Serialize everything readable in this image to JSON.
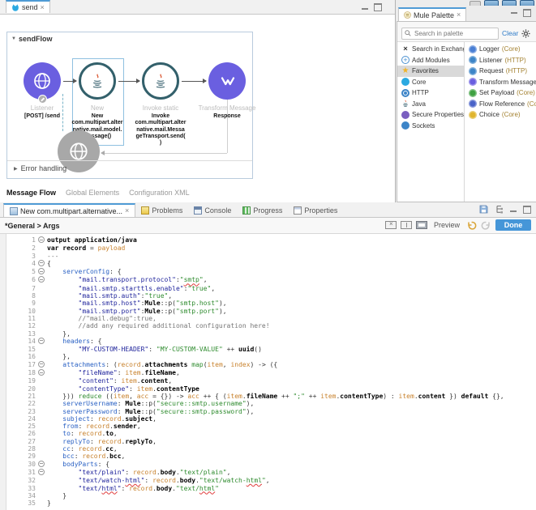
{
  "colors": {
    "accent_blue": "#4596d8",
    "link_blue": "#2f7cc9",
    "suffix_tan": "#a3802f",
    "node_purple": "#6a5fe0",
    "selection_blue": "#8fc0e0"
  },
  "icons": {
    "tri_down": "▼",
    "tri_right": "▶",
    "close": "×",
    "star": "★",
    "add": "+",
    "exchange": "×"
  },
  "flow_editor": {
    "tab": "send",
    "flow_name": "sendFlow",
    "nodes": [
      {
        "type": "Listener",
        "name_lines": [
          "[POST] /send"
        ]
      },
      {
        "type": "New",
        "name_lines": [
          "New",
          "com.multipart.alter",
          "native.mail.model.",
          "Message()"
        ],
        "selected": true
      },
      {
        "type": "Invoke static",
        "name_lines": [
          "Invoke",
          "com.multipart.alter",
          "native.mail.Messa",
          "geTransport.send(",
          ")"
        ]
      },
      {
        "type": "Transform Message",
        "name_lines": [
          "Response"
        ]
      }
    ],
    "error_handling_label": "Error handling",
    "view_tabs": [
      "Message Flow",
      "Global Elements",
      "Configuration XML"
    ]
  },
  "palette": {
    "tab": "Mule Palette",
    "search_placeholder": "Search in palette",
    "clear_label": "Clear",
    "categories": [
      {
        "label": "Search in Exchange..",
        "icon": "exchange"
      },
      {
        "label": "Add Modules",
        "icon": "add"
      },
      {
        "label": "Favorites",
        "icon": "star",
        "selected": true
      },
      {
        "label": "Core",
        "icon": "mule"
      },
      {
        "label": "HTTP",
        "icon": "http"
      },
      {
        "label": "Java",
        "icon": "java"
      },
      {
        "label": "Secure Properties",
        "icon": "secure"
      },
      {
        "label": "Sockets",
        "icon": "sockets"
      }
    ],
    "components": [
      {
        "name": "Logger",
        "suffix": "(Core)",
        "color": "#4a7fd4"
      },
      {
        "name": "Listener",
        "suffix": "(HTTP)",
        "color": "#3d85c8"
      },
      {
        "name": "Request",
        "suffix": "(HTTP)",
        "color": "#3d85c8"
      },
      {
        "name": "Transform Message",
        "suffix": "(Core)",
        "color": "#6a5fe0"
      },
      {
        "name": "Set Payload",
        "suffix": "(Core)",
        "color": "#3fa142"
      },
      {
        "name": "Flow Reference",
        "suffix": "(Core)",
        "color": "#4a63c8"
      },
      {
        "name": "Choice",
        "suffix": "(Core)",
        "color": "#e0b52e"
      }
    ]
  },
  "bottom_panel": {
    "tabs": [
      {
        "label": "New com.multipart.alternative...",
        "icon": "dwfile",
        "active": true,
        "closable": true
      },
      {
        "label": "Problems",
        "icon": "problems"
      },
      {
        "label": "Console",
        "icon": "console"
      },
      {
        "label": "Progress",
        "icon": "progress"
      },
      {
        "label": "Properties",
        "icon": "properties"
      }
    ],
    "breadcrumb": "*General > Args",
    "preview_label": "Preview",
    "done_label": "Done"
  },
  "code": {
    "lines": [
      {
        "n": 1,
        "f": 1,
        "seg": [
          [
            "output application/java",
            "k"
          ]
        ]
      },
      {
        "n": 2,
        "seg": [
          [
            "var",
            "k"
          ],
          [
            " ",
            ""
          ],
          [
            "record",
            "b"
          ],
          [
            " = ",
            ""
          ],
          [
            "payload",
            "v"
          ]
        ]
      },
      {
        "n": 3,
        "seg": [
          [
            "---",
            "c"
          ]
        ]
      },
      {
        "n": 4,
        "f": 1,
        "seg": [
          [
            "{",
            ""
          ]
        ]
      },
      {
        "n": 5,
        "f": 1,
        "seg": [
          [
            "    ",
            ""
          ],
          [
            "serverConfig",
            "key"
          ],
          [
            ": {",
            ""
          ]
        ]
      },
      {
        "n": 6,
        "f": 1,
        "seg": [
          [
            "        ",
            ""
          ],
          [
            "\"mail.transport.protocol\"",
            "q"
          ],
          [
            ":",
            ""
          ],
          [
            "\"",
            "s"
          ],
          [
            "smtp",
            "s w"
          ],
          [
            "\"",
            "s"
          ],
          [
            ",",
            ""
          ]
        ]
      },
      {
        "n": 7,
        "seg": [
          [
            "        ",
            ""
          ],
          [
            "\"mail.smtp.starttls.enable\"",
            "q"
          ],
          [
            ":",
            ""
          ],
          [
            "\"true\"",
            "s"
          ],
          [
            ",",
            ""
          ]
        ]
      },
      {
        "n": 8,
        "seg": [
          [
            "        ",
            ""
          ],
          [
            "\"mail.smtp.auth\"",
            "q"
          ],
          [
            ":",
            ""
          ],
          [
            "\"true\"",
            "s"
          ],
          [
            ",",
            ""
          ]
        ]
      },
      {
        "n": 9,
        "seg": [
          [
            "        ",
            ""
          ],
          [
            "\"mail.smtp.host\"",
            "q"
          ],
          [
            ":",
            ""
          ],
          [
            "Mule",
            "b"
          ],
          [
            "::p(",
            ""
          ],
          [
            "\"smtp.host\"",
            "s"
          ],
          [
            "),",
            ""
          ]
        ]
      },
      {
        "n": 10,
        "seg": [
          [
            "        ",
            ""
          ],
          [
            "\"mail.smtp.port\"",
            "q"
          ],
          [
            ":",
            ""
          ],
          [
            "Mule",
            "b"
          ],
          [
            "::p(",
            ""
          ],
          [
            "\"smtp.port\"",
            "s"
          ],
          [
            "),",
            ""
          ]
        ]
      },
      {
        "n": 11,
        "seg": [
          [
            "        ",
            ""
          ],
          [
            "//\"mail.debug\":true,",
            "c"
          ]
        ]
      },
      {
        "n": 12,
        "seg": [
          [
            "        ",
            ""
          ],
          [
            "//add any required additional configuration here!",
            "c"
          ]
        ]
      },
      {
        "n": 13,
        "seg": [
          [
            "    },",
            ""
          ]
        ]
      },
      {
        "n": 14,
        "f": 1,
        "seg": [
          [
            "    ",
            ""
          ],
          [
            "headers",
            "key"
          ],
          [
            ": {",
            ""
          ]
        ]
      },
      {
        "n": 15,
        "seg": [
          [
            "        ",
            ""
          ],
          [
            "\"MY-CUSTOM-HEADER\"",
            "q"
          ],
          [
            ": ",
            ""
          ],
          [
            "\"MY-CUSTOM-VALUE\"",
            "s"
          ],
          [
            " ++ ",
            ""
          ],
          [
            "uuid",
            "b"
          ],
          [
            "()",
            ""
          ]
        ]
      },
      {
        "n": 16,
        "seg": [
          [
            "    },",
            ""
          ]
        ]
      },
      {
        "n": 17,
        "f": 1,
        "seg": [
          [
            "    ",
            ""
          ],
          [
            "attachments",
            "key"
          ],
          [
            ": (",
            ""
          ],
          [
            "record",
            "v"
          ],
          [
            ".",
            ""
          ],
          [
            "attachments",
            "b"
          ],
          [
            " ",
            ""
          ],
          [
            "map",
            "f"
          ],
          [
            "(",
            ""
          ],
          [
            "item",
            "v"
          ],
          [
            ", ",
            ""
          ],
          [
            "index",
            "v"
          ],
          [
            ") -> ({",
            ""
          ]
        ]
      },
      {
        "n": 18,
        "f": 1,
        "seg": [
          [
            "        ",
            ""
          ],
          [
            "\"fileName\"",
            "q"
          ],
          [
            ": ",
            ""
          ],
          [
            "item",
            "v"
          ],
          [
            ".",
            ""
          ],
          [
            "fileName",
            "b"
          ],
          [
            ",",
            ""
          ]
        ]
      },
      {
        "n": 19,
        "seg": [
          [
            "        ",
            ""
          ],
          [
            "\"content\"",
            "q"
          ],
          [
            ": ",
            ""
          ],
          [
            "item",
            "v"
          ],
          [
            ".",
            ""
          ],
          [
            "content",
            "b"
          ],
          [
            ",",
            ""
          ]
        ]
      },
      {
        "n": 20,
        "seg": [
          [
            "        ",
            ""
          ],
          [
            "\"contentType\"",
            "q"
          ],
          [
            ": ",
            ""
          ],
          [
            "item",
            "v"
          ],
          [
            ".",
            ""
          ],
          [
            "contentType",
            "b"
          ]
        ]
      },
      {
        "n": 21,
        "seg": [
          [
            "    })) ",
            ""
          ],
          [
            "reduce",
            "f"
          ],
          [
            " ((",
            ""
          ],
          [
            "item",
            "v"
          ],
          [
            ", ",
            ""
          ],
          [
            "acc",
            "v"
          ],
          [
            " = {}) -> ",
            ""
          ],
          [
            "acc",
            "v"
          ],
          [
            " ++ { (",
            ""
          ],
          [
            "item",
            "v"
          ],
          [
            ".",
            ""
          ],
          [
            "fileName",
            "b"
          ],
          [
            " ++ ",
            ""
          ],
          [
            "\";\"",
            "s"
          ],
          [
            " ++ ",
            ""
          ],
          [
            "item",
            "v"
          ],
          [
            ".",
            ""
          ],
          [
            "contentType",
            "b"
          ],
          [
            ") : ",
            ""
          ],
          [
            "item",
            "v"
          ],
          [
            ".",
            ""
          ],
          [
            "content",
            "b"
          ],
          [
            " }) ",
            ""
          ],
          [
            "default",
            "k"
          ],
          [
            " {},",
            ""
          ]
        ]
      },
      {
        "n": 22,
        "seg": [
          [
            "    ",
            ""
          ],
          [
            "serverUsername",
            "key"
          ],
          [
            ": ",
            ""
          ],
          [
            "Mule",
            "b"
          ],
          [
            "::p(",
            ""
          ],
          [
            "\"secure::smtp.username\"",
            "s"
          ],
          [
            "),",
            ""
          ]
        ]
      },
      {
        "n": 23,
        "seg": [
          [
            "    ",
            ""
          ],
          [
            "serverPassword",
            "key"
          ],
          [
            ": ",
            ""
          ],
          [
            "Mule",
            "b"
          ],
          [
            "::p(",
            ""
          ],
          [
            "\"secure::smtp.password\"",
            "s"
          ],
          [
            "),",
            ""
          ]
        ]
      },
      {
        "n": 24,
        "seg": [
          [
            "    ",
            ""
          ],
          [
            "subject",
            "key"
          ],
          [
            ": ",
            ""
          ],
          [
            "record",
            "v"
          ],
          [
            ".",
            ""
          ],
          [
            "subject",
            "b"
          ],
          [
            ",",
            ""
          ]
        ]
      },
      {
        "n": 25,
        "seg": [
          [
            "    ",
            ""
          ],
          [
            "from",
            "key"
          ],
          [
            ": ",
            ""
          ],
          [
            "record",
            "v"
          ],
          [
            ".",
            ""
          ],
          [
            "sender",
            "b"
          ],
          [
            ",",
            ""
          ]
        ]
      },
      {
        "n": 26,
        "seg": [
          [
            "    ",
            ""
          ],
          [
            "to",
            "key"
          ],
          [
            ": ",
            ""
          ],
          [
            "record",
            "v"
          ],
          [
            ".",
            ""
          ],
          [
            "to",
            "b"
          ],
          [
            ",",
            ""
          ]
        ]
      },
      {
        "n": 27,
        "seg": [
          [
            "    ",
            ""
          ],
          [
            "replyTo",
            "key"
          ],
          [
            ": ",
            ""
          ],
          [
            "record",
            "v"
          ],
          [
            ".",
            ""
          ],
          [
            "replyTo",
            "b"
          ],
          [
            ",",
            ""
          ]
        ]
      },
      {
        "n": 28,
        "seg": [
          [
            "    ",
            ""
          ],
          [
            "cc",
            "key"
          ],
          [
            ": ",
            ""
          ],
          [
            "record",
            "v"
          ],
          [
            ".",
            ""
          ],
          [
            "cc",
            "b"
          ],
          [
            ",",
            ""
          ]
        ]
      },
      {
        "n": 29,
        "seg": [
          [
            "    ",
            ""
          ],
          [
            "bcc",
            "key"
          ],
          [
            ": ",
            ""
          ],
          [
            "record",
            "v"
          ],
          [
            ".",
            ""
          ],
          [
            "bcc",
            "b"
          ],
          [
            ",",
            ""
          ]
        ]
      },
      {
        "n": 30,
        "f": 1,
        "seg": [
          [
            "    ",
            ""
          ],
          [
            "bodyParts",
            "key"
          ],
          [
            ": {",
            ""
          ]
        ]
      },
      {
        "n": 31,
        "f": 1,
        "seg": [
          [
            "        ",
            ""
          ],
          [
            "\"text/plain\"",
            "q"
          ],
          [
            ": ",
            ""
          ],
          [
            "record",
            "v"
          ],
          [
            ".",
            ""
          ],
          [
            "body",
            "b"
          ],
          [
            ".",
            ""
          ],
          [
            "\"text/plain\"",
            "s"
          ],
          [
            ",",
            ""
          ]
        ]
      },
      {
        "n": 32,
        "seg": [
          [
            "        ",
            ""
          ],
          [
            "\"text/watch-",
            "q"
          ],
          [
            "html",
            "q w"
          ],
          [
            "\"",
            "q"
          ],
          [
            ": ",
            ""
          ],
          [
            "record",
            "v"
          ],
          [
            ".",
            ""
          ],
          [
            "body",
            "b"
          ],
          [
            ".",
            ""
          ],
          [
            "\"text/watch-",
            "s"
          ],
          [
            "html",
            "s w"
          ],
          [
            "\"",
            "s"
          ],
          [
            ",",
            ""
          ]
        ]
      },
      {
        "n": 33,
        "seg": [
          [
            "        ",
            ""
          ],
          [
            "\"text/",
            "q"
          ],
          [
            "html",
            "q w"
          ],
          [
            "\"",
            "q"
          ],
          [
            ": ",
            ""
          ],
          [
            "record",
            "v"
          ],
          [
            ".",
            ""
          ],
          [
            "body",
            "b"
          ],
          [
            ".",
            ""
          ],
          [
            "\"text/",
            "s"
          ],
          [
            "html",
            "s w"
          ],
          [
            "\"",
            "s"
          ]
        ]
      },
      {
        "n": 34,
        "seg": [
          [
            "    }",
            ""
          ]
        ]
      },
      {
        "n": 35,
        "seg": [
          [
            "}",
            ""
          ]
        ]
      }
    ]
  }
}
